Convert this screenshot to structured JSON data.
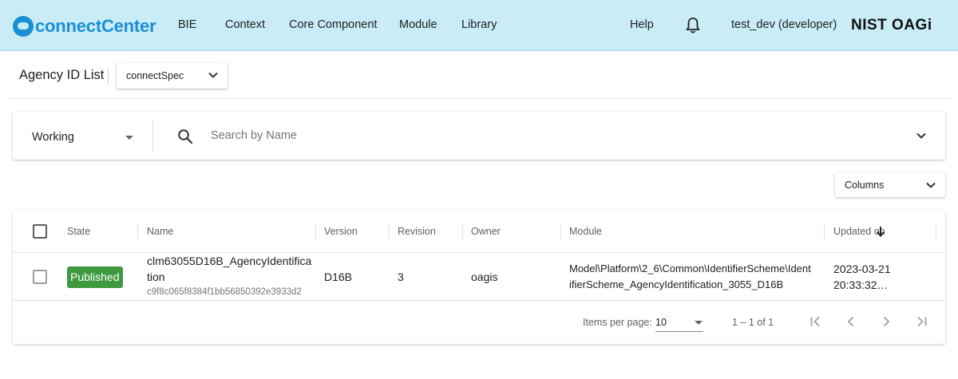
{
  "header": {
    "logo_text": "connectCenter",
    "nav": [
      "BIE",
      "Context",
      "Core Component",
      "Module",
      "Library"
    ],
    "help_label": "Help",
    "user_label": "test_dev (developer)",
    "brand_label": "NIST OAGi",
    "background_color": "#c9ecf6",
    "icons": {
      "logo": "connect-logo-icon",
      "notifications": "bell-icon"
    }
  },
  "page": {
    "title": "Agency ID List",
    "release_select": {
      "value": "connectSpec"
    }
  },
  "search": {
    "state_value": "Working",
    "placeholder": "Search by Name",
    "icons": {
      "search": "search-icon",
      "expand": "chevron-down-icon"
    }
  },
  "columns_button": {
    "label": "Columns"
  },
  "table": {
    "headers": [
      "State",
      "Name",
      "Version",
      "Revision",
      "Owner",
      "Module",
      "Updated on"
    ],
    "sort_icon": "arrow-down-icon",
    "rows": [
      {
        "state": "Published",
        "name_line1": "clm63055D16B_AgencyIdentifica",
        "name_line2": "tion",
        "guid": "c9f8c065f8384f1bb56850392e3933d2",
        "version": "D16B",
        "revision": "3",
        "owner": "oagis",
        "module_line1": "Model\\Platform\\2_6\\Common\\IdentifierScheme\\Ident",
        "module_line2": "ifierScheme_AgencyIdentification_3055_D16B",
        "updated_line1": "2023-03-21",
        "updated_line2": "20:33:32…"
      }
    ],
    "state_badge_color": "#3f9a3f"
  },
  "paginator": {
    "items_per_page_label": "Items per page:",
    "page_size": "10",
    "range_label": "1 – 1 of 1",
    "icons": [
      "first-page-icon",
      "previous-page-icon",
      "next-page-icon",
      "last-page-icon"
    ]
  }
}
